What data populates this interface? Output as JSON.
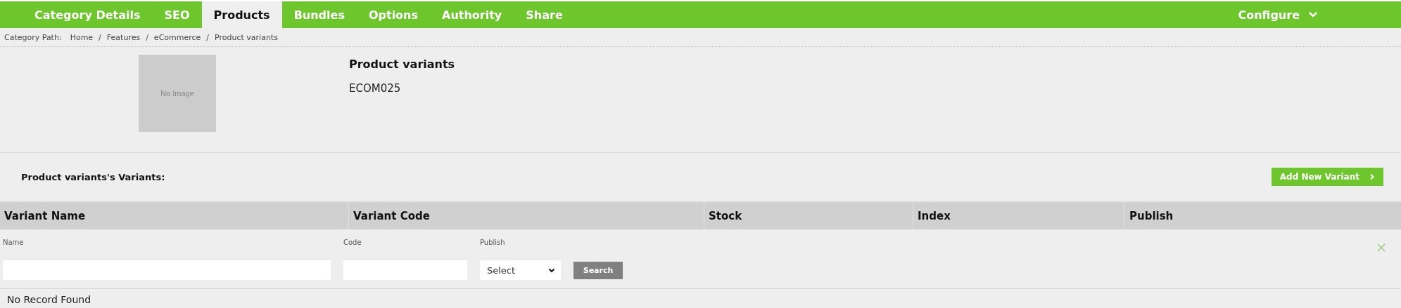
{
  "tabs": [
    {
      "label": "Category Details",
      "selected": false
    },
    {
      "label": "SEO",
      "selected": false
    },
    {
      "label": "Products",
      "selected": true
    },
    {
      "label": "Bundles",
      "selected": false
    },
    {
      "label": "Options",
      "selected": false
    },
    {
      "label": "Authority",
      "selected": false
    },
    {
      "label": "Share",
      "selected": false
    }
  ],
  "configure_menu": {
    "label": "Configure"
  },
  "breadcrumb": {
    "label": "Category Path:",
    "separator": "/",
    "items": [
      "Home",
      "Features",
      "eCommerce",
      "Product variants"
    ]
  },
  "product": {
    "image_placeholder": "No Image",
    "name": "Product variants",
    "code": "ECOM025"
  },
  "variants": {
    "title": "Product variants's Variants:",
    "add_button": "Add New Variant",
    "table": {
      "columns": [
        "Variant Name",
        "Variant Code",
        "Stock",
        "Index",
        "Publish"
      ],
      "filters": [
        {
          "kind": "text",
          "label": "Name"
        },
        {
          "kind": "text",
          "label": "Code"
        },
        {
          "kind": "select",
          "label": "Publish",
          "value": "Select"
        }
      ],
      "search_button": "Search",
      "empty_message": "No Record Found"
    }
  }
}
